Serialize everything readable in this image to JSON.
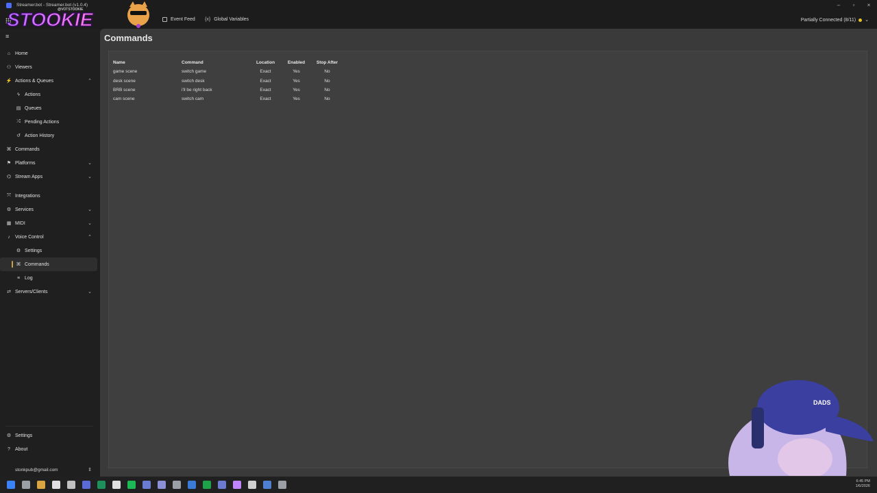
{
  "window": {
    "title": "Streamer.bot - Streamer.bot (v1.0.4)"
  },
  "topbar": {
    "items": [
      {
        "label": "Event Feed",
        "icon": "list-icon"
      },
      {
        "label": "Global Variables",
        "icon": "variable-icon",
        "icon_glyph": "{x}"
      }
    ],
    "connection": "Partially Connected (8/11)",
    "connection_color": "#e6c229"
  },
  "logo": {
    "text": "STOOKIE",
    "handle": "@VOTSTOOKIE"
  },
  "sidebar": {
    "items": [
      {
        "label": "Home",
        "icon": "home-icon",
        "glyph": "⌂"
      },
      {
        "label": "Viewers",
        "icon": "viewers-icon",
        "glyph": "⚇"
      },
      {
        "label": "Actions & Queues",
        "icon": "actions-icon",
        "glyph": "⚡",
        "chevron": "⌃"
      },
      {
        "label": "Actions",
        "icon": "action-icon",
        "glyph": "ϟ",
        "sub": true
      },
      {
        "label": "Queues",
        "icon": "queues-icon",
        "glyph": "▤",
        "sub": true
      },
      {
        "label": "Pending Actions",
        "icon": "pending-icon",
        "glyph": "⤮",
        "sub": true
      },
      {
        "label": "Action History",
        "icon": "history-icon",
        "glyph": "↺",
        "sub": true
      },
      {
        "label": "Commands",
        "icon": "commands-icon",
        "glyph": "⌘"
      },
      {
        "label": "Platforms",
        "icon": "platforms-icon",
        "glyph": "⚑",
        "chevron": "⌄"
      },
      {
        "label": "Stream Apps",
        "icon": "stream-apps-icon",
        "glyph": "⌬",
        "chevron": "⌄"
      },
      {
        "label": "Integrations",
        "icon": "integrations-icon",
        "glyph": "⤧",
        "gap": true
      },
      {
        "label": "Services",
        "icon": "services-icon",
        "glyph": "⚙",
        "chevron": "⌄"
      },
      {
        "label": "MIDI",
        "icon": "midi-icon",
        "glyph": "▦",
        "chevron": "⌄"
      },
      {
        "label": "Voice Control",
        "icon": "voice-control-icon",
        "glyph": "♪",
        "chevron": "⌃"
      },
      {
        "label": "Settings",
        "icon": "settings-icon",
        "glyph": "⚙",
        "sub": true
      },
      {
        "label": "Commands",
        "icon": "commands-icon",
        "glyph": "⌘",
        "sub": true,
        "active": true
      },
      {
        "label": "Log",
        "icon": "log-icon",
        "glyph": "≡",
        "sub": true
      },
      {
        "label": "Servers/Clients",
        "icon": "servers-icon",
        "glyph": "⇄",
        "chevron": "⌄"
      }
    ],
    "bottom": [
      {
        "label": "Settings",
        "icon": "settings-icon",
        "glyph": "⚙"
      },
      {
        "label": "About",
        "icon": "about-icon",
        "glyph": "?"
      }
    ],
    "user": "stonkpub@gmail.com"
  },
  "main": {
    "title": "Commands",
    "table": {
      "headers": [
        "Name",
        "Command",
        "Location",
        "Enabled",
        "Stop After"
      ],
      "rows": [
        [
          "game scene",
          "switch game",
          "Exact",
          "Yes",
          "No"
        ],
        [
          "desk scene",
          "switch desk",
          "Exact",
          "Yes",
          "No"
        ],
        [
          "BRB scene",
          "i'll be right back",
          "Exact",
          "Yes",
          "No"
        ],
        [
          "cam scene",
          "switch cam",
          "Exact",
          "Yes",
          "No"
        ]
      ]
    }
  },
  "taskbar": {
    "apps": [
      "windows-start-icon",
      "search-icon",
      "file-explorer-icon",
      "app-icon",
      "terminal-icon",
      "app-icon",
      "app-icon",
      "app-icon",
      "spotify-icon",
      "app-icon",
      "app-icon",
      "app-icon",
      "steam-icon",
      "app-icon",
      "app-icon",
      "app-icon",
      "app-icon",
      "app-icon",
      "app-icon"
    ],
    "time": "6:45 PM",
    "date": "1/6/2026"
  },
  "colors": {
    "accent": "#c8a24a",
    "bg": "#1f1f1f",
    "panel": "#3f3f3f"
  }
}
